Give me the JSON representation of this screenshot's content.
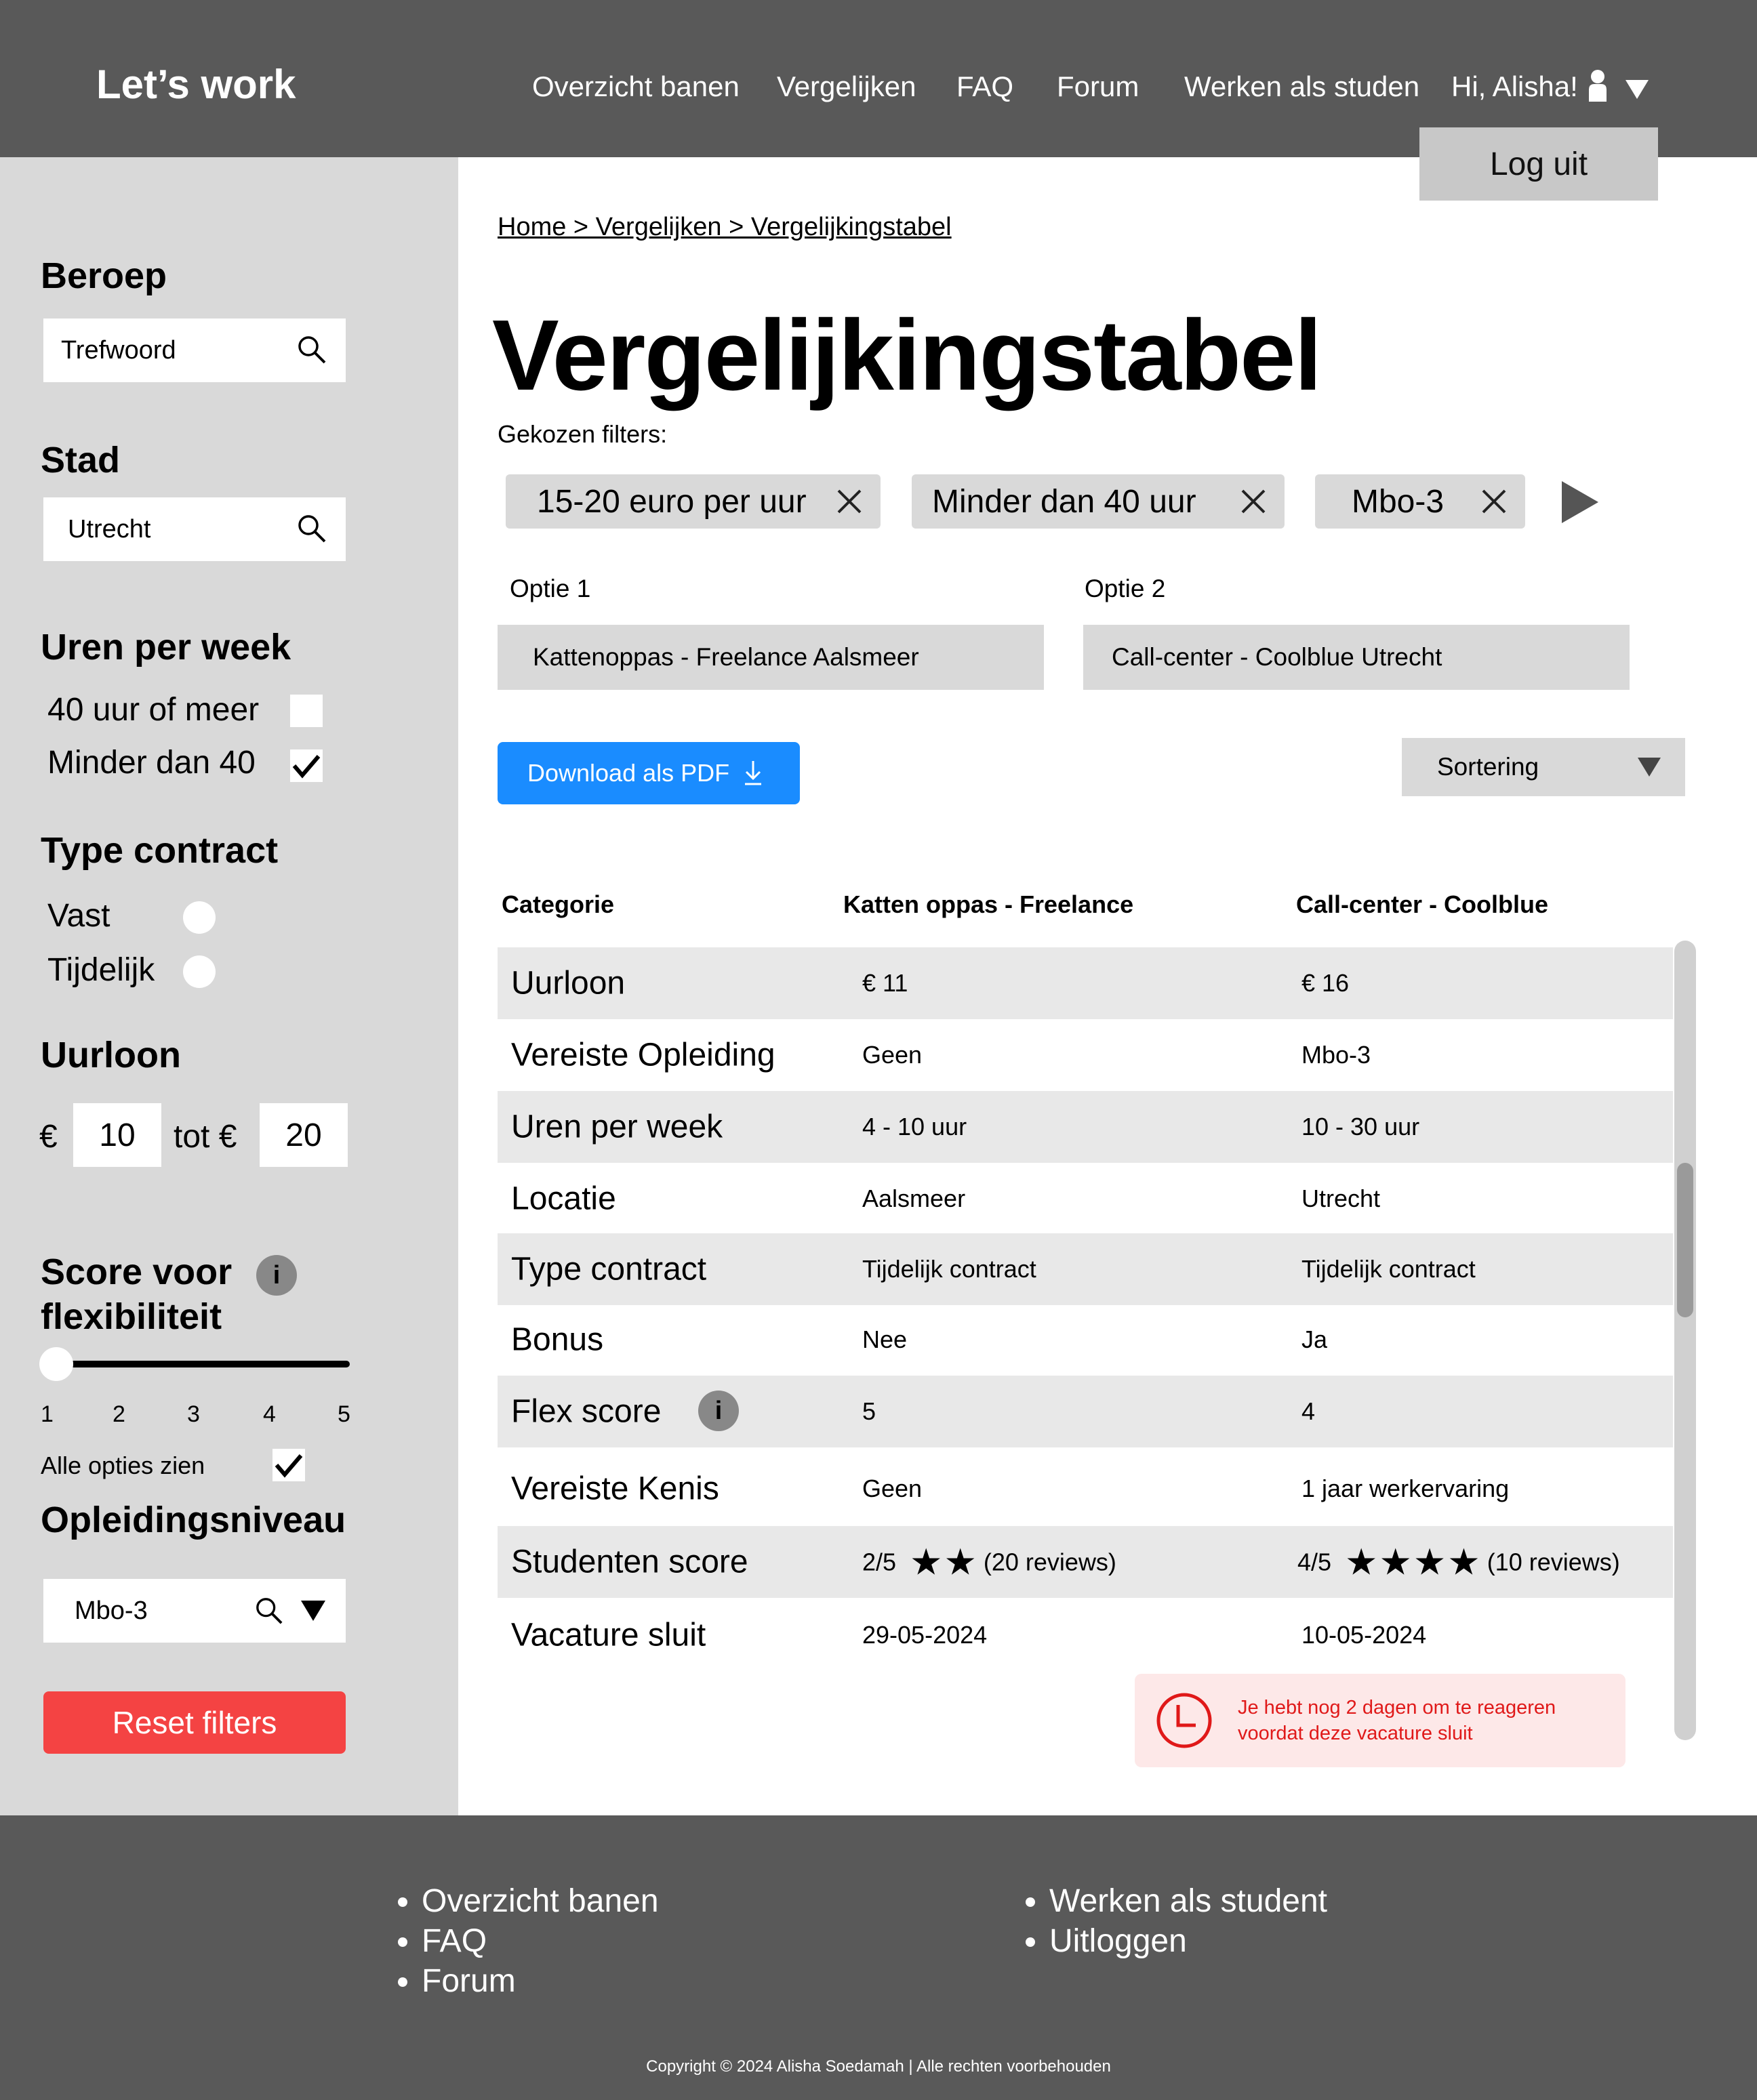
{
  "header": {
    "logo": "Let’s work",
    "nav": [
      "Overzicht banen",
      "Vergelijken",
      "FAQ",
      "Forum",
      "Werken als studen"
    ],
    "greeting": "Hi, Alisha!",
    "logout_label": "Log uit"
  },
  "sidebar": {
    "beroep": {
      "title": "Beroep",
      "placeholder": "Trefwoord"
    },
    "stad": {
      "title": "Stad",
      "value": "Utrecht"
    },
    "uren": {
      "title": "Uren per week",
      "options": [
        {
          "label": "40 uur of meer",
          "checked": false
        },
        {
          "label": "Minder dan 40",
          "checked": true
        }
      ]
    },
    "contract": {
      "title": "Type contract",
      "options": [
        {
          "label": "Vast",
          "selected": false
        },
        {
          "label": "Tijdelijk",
          "selected": false
        }
      ]
    },
    "uurloon": {
      "title": "Uurloon",
      "currency": "€",
      "min": "10",
      "between": "tot €",
      "max": "20"
    },
    "flex": {
      "title_line1": "Score voor",
      "title_line2": "flexibiliteit",
      "info": "i",
      "ticks": [
        "1",
        "2",
        "3",
        "4",
        "5"
      ],
      "slider_value": 1,
      "all_label": "Alle opties zien",
      "all_checked": true
    },
    "opleiding": {
      "title": "Opleidingsniveau",
      "value": "Mbo-3"
    },
    "reset_label": "Reset filters"
  },
  "main": {
    "breadcrumb": "Home > Vergelijken > Vergelijkingstabel",
    "title": "Vergelijkingstabel",
    "filters_label": "Gekozen filters:",
    "chips": [
      "15-20 euro per uur",
      "Minder dan 40 uur",
      "Mbo-3"
    ],
    "option1": {
      "label": "Optie 1",
      "value": "Kattenoppas - Freelance Aalsmeer"
    },
    "option2": {
      "label": "Optie 2",
      "value": "Call-center - Coolblue Utrecht"
    },
    "pdf_label": "Download als PDF",
    "sort_label": "Sortering",
    "table": {
      "headers": [
        "Categorie",
        "Katten oppas - Freelance",
        "Call-center - Coolblue"
      ],
      "rows": [
        {
          "cat": "Uurloon",
          "v1": "€ 11",
          "v2": "€ 16"
        },
        {
          "cat": "Vereiste Opleiding",
          "v1": "Geen",
          "v2": "Mbo-3"
        },
        {
          "cat": "Uren per week",
          "v1": "4 - 10 uur",
          "v2": "10 - 30 uur"
        },
        {
          "cat": "Locatie",
          "v1": "Aalsmeer",
          "v2": "Utrecht"
        },
        {
          "cat": "Type contract",
          "v1": "Tijdelijk contract",
          "v2": "Tijdelijk contract"
        },
        {
          "cat": "Bonus",
          "v1": "Nee",
          "v2": "Ja"
        },
        {
          "cat": "Flex score",
          "v1": "5",
          "v2": "4",
          "info": "i"
        },
        {
          "cat": "Vereiste Kenis",
          "v1": "Geen",
          "v2": "1 jaar werkervaring"
        },
        {
          "cat": "Studenten score",
          "v1": "2/5",
          "v1_stars": "★★",
          "v1_reviews": "(20 reviews)",
          "v2": "4/5",
          "v2_stars": "★★★★",
          "v2_reviews": "(10 reviews)"
        },
        {
          "cat": "Vacature sluit",
          "v1": "29-05-2024",
          "v2": "10-05-2024"
        }
      ]
    },
    "alert": {
      "line1": "Je hebt nog 2 dagen om te reageren",
      "line2": "voordat deze vacature sluit"
    }
  },
  "footer": {
    "col1": [
      "Overzicht banen",
      "FAQ",
      "Forum"
    ],
    "col2": [
      "Werken als student",
      "Uitloggen"
    ],
    "copyright": "Copyright © 2024 Alisha Soedamah | Alle rechten voorbehouden"
  }
}
